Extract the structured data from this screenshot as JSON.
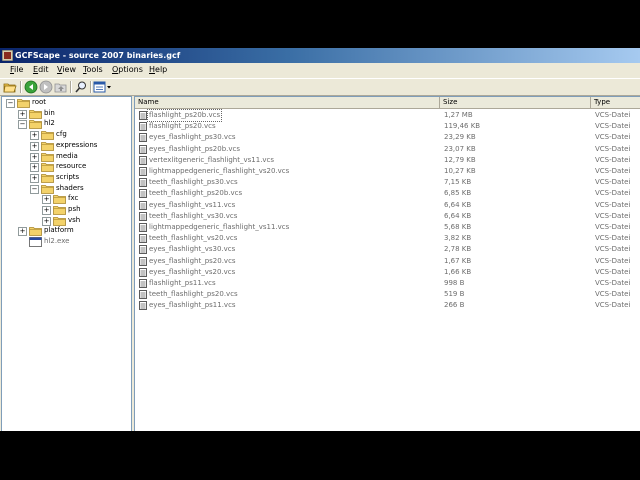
{
  "window": {
    "title": "GCFScape - source 2007 binaries.gcf"
  },
  "menu": [
    {
      "label": "File",
      "ul": "F",
      "rest": "ile"
    },
    {
      "label": "Edit",
      "ul": "E",
      "rest": "dit"
    },
    {
      "label": "View",
      "ul": "V",
      "rest": "iew"
    },
    {
      "label": "Tools",
      "ul": "T",
      "rest": "ools"
    },
    {
      "label": "Options",
      "ul": "O",
      "rest": "ptions"
    },
    {
      "label": "Help",
      "ul": "H",
      "rest": "elp"
    }
  ],
  "toolbar": {
    "icons": [
      "open-folder-icon",
      "back-icon",
      "forward-icon",
      "up-icon",
      "find-icon",
      "view-mode-icon"
    ]
  },
  "tree": [
    {
      "label": "root",
      "depth": 0
    },
    {
      "label": "bin",
      "depth": 1
    },
    {
      "label": "hl2",
      "depth": 1
    },
    {
      "label": "cfg",
      "depth": 2
    },
    {
      "label": "expressions",
      "depth": 2
    },
    {
      "label": "media",
      "depth": 2
    },
    {
      "label": "resource",
      "depth": 2
    },
    {
      "label": "scripts",
      "depth": 2
    },
    {
      "label": "shaders",
      "depth": 2
    },
    {
      "label": "fxc",
      "depth": 3
    },
    {
      "label": "psh",
      "depth": 3
    },
    {
      "label": "vsh",
      "depth": 3
    },
    {
      "label": "platform",
      "depth": 1
    },
    {
      "label": "hl2.exe",
      "depth": 1
    }
  ],
  "list": {
    "columns": {
      "name": "Name",
      "size": "Size",
      "type": "Type"
    },
    "rows": [
      {
        "name": "flashlight_ps20b.vcs",
        "size": "1,27 MB",
        "type": "VCS-Datei"
      },
      {
        "name": "flashlight_ps20.vcs",
        "size": "119,46 KB",
        "type": "VCS-Datei"
      },
      {
        "name": "eyes_flashlight_ps30.vcs",
        "size": "23,29 KB",
        "type": "VCS-Datei"
      },
      {
        "name": "eyes_flashlight_ps20b.vcs",
        "size": "23,07 KB",
        "type": "VCS-Datei"
      },
      {
        "name": "vertexlitgeneric_flashlight_vs11.vcs",
        "size": "12,79 KB",
        "type": "VCS-Datei"
      },
      {
        "name": "lightmappedgeneric_flashlight_vs20.vcs",
        "size": "10,27 KB",
        "type": "VCS-Datei"
      },
      {
        "name": "teeth_flashlight_ps30.vcs",
        "size": "7,15 KB",
        "type": "VCS-Datei"
      },
      {
        "name": "teeth_flashlight_ps20b.vcs",
        "size": "6,85 KB",
        "type": "VCS-Datei"
      },
      {
        "name": "eyes_flashlight_vs11.vcs",
        "size": "6,64 KB",
        "type": "VCS-Datei"
      },
      {
        "name": "teeth_flashlight_vs30.vcs",
        "size": "6,64 KB",
        "type": "VCS-Datei"
      },
      {
        "name": "lightmappedgeneric_flashlight_vs11.vcs",
        "size": "5,68 KB",
        "type": "VCS-Datei"
      },
      {
        "name": "teeth_flashlight_vs20.vcs",
        "size": "3,82 KB",
        "type": "VCS-Datei"
      },
      {
        "name": "eyes_flashlight_vs30.vcs",
        "size": "2,78 KB",
        "type": "VCS-Datei"
      },
      {
        "name": "eyes_flashlight_ps20.vcs",
        "size": "1,67 KB",
        "type": "VCS-Datei"
      },
      {
        "name": "eyes_flashlight_vs20.vcs",
        "size": "1,66 KB",
        "type": "VCS-Datei"
      },
      {
        "name": "flashlight_ps11.vcs",
        "size": "998 B",
        "type": "VCS-Datei"
      },
      {
        "name": "teeth_flashlight_ps20.vcs",
        "size": "519 B",
        "type": "VCS-Datei"
      },
      {
        "name": "eyes_flashlight_ps11.vcs",
        "size": "266 B",
        "type": "VCS-Datei"
      }
    ]
  }
}
